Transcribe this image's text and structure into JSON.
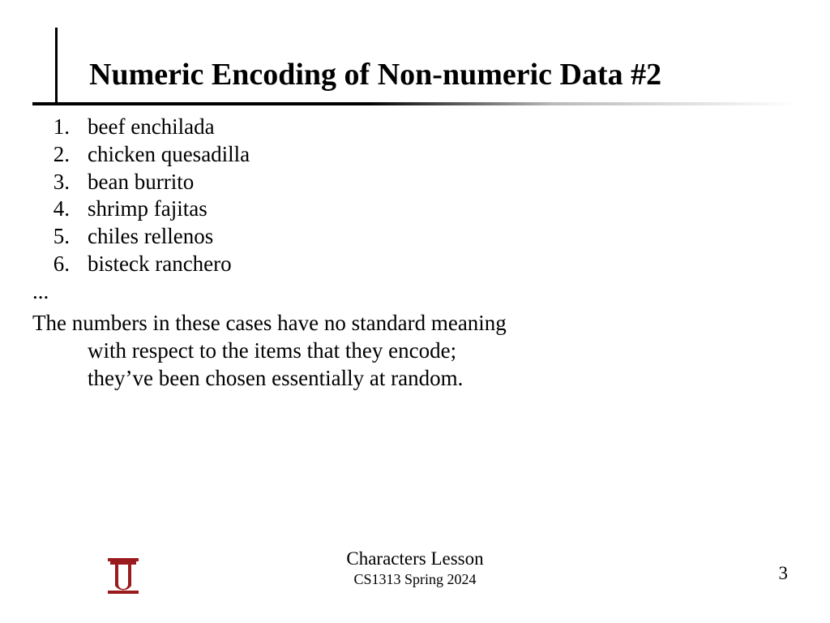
{
  "title": "Numeric Encoding of Non-numeric Data #2",
  "list": {
    "items": [
      {
        "num": "1.",
        "text": "beef enchilada"
      },
      {
        "num": "2.",
        "text": "chicken quesadilla"
      },
      {
        "num": "3.",
        "text": "bean burrito"
      },
      {
        "num": "4.",
        "text": "shrimp fajitas"
      },
      {
        "num": "5.",
        "text": "chiles rellenos"
      },
      {
        "num": "6.",
        "text": "bisteck ranchero"
      }
    ],
    "ellipsis": "..."
  },
  "paragraph": {
    "line1": "The numbers in these cases have no standard meaning",
    "line2": "with respect to the items that they encode;",
    "line3": "they’ve been chosen essentially at random."
  },
  "footer": {
    "lesson": "Characters Lesson",
    "course": "CS1313 Spring 2024",
    "page": "3"
  },
  "logo": {
    "name": "ou-logo",
    "color": "#9a1b1e"
  }
}
